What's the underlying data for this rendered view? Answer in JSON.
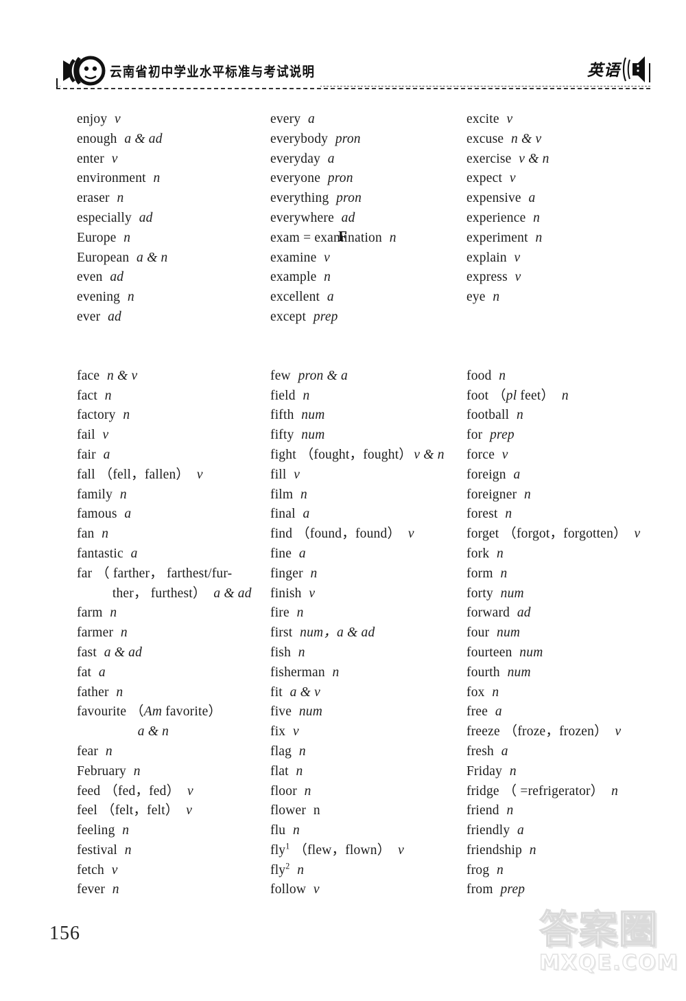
{
  "header": {
    "title_cn": "云南省初中学业水平标准与考试说明",
    "subject_cn": "英语",
    "left_icon": "headphones-icon",
    "right_icon": "speaker-icon"
  },
  "section_letter": "F",
  "page_number": "156",
  "watermark": {
    "text_cn": "答案圈",
    "url": "MXQE.COM"
  },
  "columns": [
    {
      "id": "col-1",
      "e_entries": [
        {
          "word": "enjoy",
          "pos": "v"
        },
        {
          "word": "enough",
          "pos": "a & ad"
        },
        {
          "word": "enter",
          "pos": "v"
        },
        {
          "word": "environment",
          "pos": "n"
        },
        {
          "word": "eraser",
          "pos": "n"
        },
        {
          "word": "especially",
          "pos": "ad"
        },
        {
          "word": "Europe",
          "pos": "n"
        },
        {
          "word": "European",
          "pos": "a & n"
        },
        {
          "word": "even",
          "pos": "ad"
        },
        {
          "word": "evening",
          "pos": "n"
        },
        {
          "word": "ever",
          "pos": "ad"
        }
      ],
      "f_entries": [
        {
          "word": "face",
          "pos": "n & v"
        },
        {
          "word": "fact",
          "pos": "n"
        },
        {
          "word": "factory",
          "pos": "n"
        },
        {
          "word": "fail",
          "pos": "v"
        },
        {
          "word": "fair",
          "pos": "a"
        },
        {
          "word": "fall",
          "forms": "（fell，fallen）",
          "pos": "v"
        },
        {
          "word": "family",
          "pos": "n"
        },
        {
          "word": "famous",
          "pos": "a"
        },
        {
          "word": "fan",
          "pos": "n"
        },
        {
          "word": "fantastic",
          "pos": "a"
        },
        {
          "word": "far",
          "forms": "（ farther， farthest/fur-",
          "pos": ""
        },
        {
          "continuation": true,
          "text": "ther， furthest）",
          "pos": "a & ad"
        },
        {
          "word": "farm",
          "pos": "n"
        },
        {
          "word": "farmer",
          "pos": "n"
        },
        {
          "word": "fast",
          "pos": "a & ad"
        },
        {
          "word": "fat",
          "pos": "a"
        },
        {
          "word": "father",
          "pos": "n"
        },
        {
          "word": "favourite",
          "forms_italic_prefix": "（",
          "forms_italic": "Am",
          "forms_rest": " favorite）",
          "pos": ""
        },
        {
          "continuation_wide": true,
          "text": "",
          "pos": "a & n"
        },
        {
          "word": "fear",
          "pos": "n"
        },
        {
          "word": "February",
          "pos": "n"
        },
        {
          "word": "feed",
          "forms": "（fed，fed）",
          "pos": "v"
        },
        {
          "word": "feel",
          "forms": "（felt，felt）",
          "pos": "v"
        },
        {
          "word": "feeling",
          "pos": "n"
        },
        {
          "word": "festival",
          "pos": "n"
        },
        {
          "word": "fetch",
          "pos": "v"
        },
        {
          "word": "fever",
          "pos": "n"
        }
      ]
    },
    {
      "id": "col-2",
      "e_entries": [
        {
          "word": "every",
          "pos": "a"
        },
        {
          "word": "everybody",
          "pos": "pron"
        },
        {
          "word": "everyday",
          "pos": "a"
        },
        {
          "word": "everyone",
          "pos": "pron"
        },
        {
          "word": "everything",
          "pos": "pron"
        },
        {
          "word": "everywhere",
          "pos": "ad"
        },
        {
          "word": "exam = examination",
          "pos": "n"
        },
        {
          "word": "examine",
          "pos": "v"
        },
        {
          "word": "example",
          "pos": "n"
        },
        {
          "word": "excellent",
          "pos": "a"
        },
        {
          "word": "except",
          "pos": "prep"
        }
      ],
      "f_entries": [
        {
          "word": "few",
          "pos": "pron & a"
        },
        {
          "word": "field",
          "pos": "n"
        },
        {
          "word": "fifth",
          "pos": "num"
        },
        {
          "word": "fifty",
          "pos": "num"
        },
        {
          "word": "fight",
          "forms": "（fought，fought）",
          "pos": "v & n",
          "tight": true
        },
        {
          "word": "fill",
          "pos": "v"
        },
        {
          "word": "film",
          "pos": "n"
        },
        {
          "word": "final",
          "pos": "a"
        },
        {
          "word": "find",
          "forms": "（found，found）",
          "pos": "v"
        },
        {
          "word": "fine",
          "pos": "a"
        },
        {
          "word": "finger",
          "pos": "n"
        },
        {
          "word": "finish",
          "pos": "v"
        },
        {
          "word": "fire",
          "pos": "n"
        },
        {
          "word": "first",
          "pos": "num，a & ad"
        },
        {
          "word": "fish",
          "pos": "n"
        },
        {
          "word": "fisherman",
          "pos": "n"
        },
        {
          "word": "fit",
          "pos": "a & v"
        },
        {
          "word": "five",
          "pos": "num"
        },
        {
          "word": "fix",
          "pos": "v"
        },
        {
          "word": "flag",
          "pos": "n"
        },
        {
          "word": "flat",
          "pos": "n"
        },
        {
          "word": "floor",
          "pos": "n"
        },
        {
          "word": "flower",
          "pos": "n",
          "pos_upright": true
        },
        {
          "word": "flu",
          "pos": "n"
        },
        {
          "word": "fly",
          "sup": "1",
          "forms": "（flew，flown）",
          "pos": "v"
        },
        {
          "word": "fly",
          "sup": "2",
          "pos": "n"
        },
        {
          "word": "follow",
          "pos": "v"
        }
      ]
    },
    {
      "id": "col-3",
      "e_entries": [
        {
          "word": "excite",
          "pos": "v"
        },
        {
          "word": "excuse",
          "pos": "n & v"
        },
        {
          "word": "exercise",
          "pos": "v & n"
        },
        {
          "word": "expect",
          "pos": "v"
        },
        {
          "word": "expensive",
          "pos": "a"
        },
        {
          "word": "experience",
          "pos": "n"
        },
        {
          "word": "experiment",
          "pos": "n"
        },
        {
          "word": "explain",
          "pos": "v"
        },
        {
          "word": "express",
          "pos": "v"
        },
        {
          "word": "eye",
          "pos": "n"
        }
      ],
      "f_entries": [
        {
          "word": "food",
          "pos": "n"
        },
        {
          "word": "foot",
          "forms_italic_prefix": "（",
          "forms_italic": "pl",
          "forms_rest": " feet）",
          "pos": "n"
        },
        {
          "word": "football",
          "pos": "n"
        },
        {
          "word": "for",
          "pos": "prep"
        },
        {
          "word": "force",
          "pos": "v"
        },
        {
          "word": "foreign",
          "pos": "a"
        },
        {
          "word": "foreigner",
          "pos": "n"
        },
        {
          "word": "forest",
          "pos": "n"
        },
        {
          "word": "forget",
          "forms": "（forgot，forgotten）",
          "pos": "v"
        },
        {
          "word": "fork",
          "pos": "n"
        },
        {
          "word": "form",
          "pos": "n"
        },
        {
          "word": "forty",
          "pos": "num"
        },
        {
          "word": "forward",
          "pos": "ad"
        },
        {
          "word": "four",
          "pos": "num"
        },
        {
          "word": "fourteen",
          "pos": "num"
        },
        {
          "word": "fourth",
          "pos": "num"
        },
        {
          "word": "fox",
          "pos": "n"
        },
        {
          "word": "free",
          "pos": "a"
        },
        {
          "word": "freeze",
          "forms": "（froze，frozen）",
          "pos": "v"
        },
        {
          "word": "fresh",
          "pos": "a"
        },
        {
          "word": "Friday",
          "pos": "n"
        },
        {
          "word": "fridge",
          "forms": "（ =refrigerator）",
          "pos": "n"
        },
        {
          "word": "friend",
          "pos": "n"
        },
        {
          "word": "friendly",
          "pos": "a"
        },
        {
          "word": "friendship",
          "pos": "n"
        },
        {
          "word": "frog",
          "pos": "n"
        },
        {
          "word": "from",
          "pos": "prep"
        }
      ]
    }
  ]
}
